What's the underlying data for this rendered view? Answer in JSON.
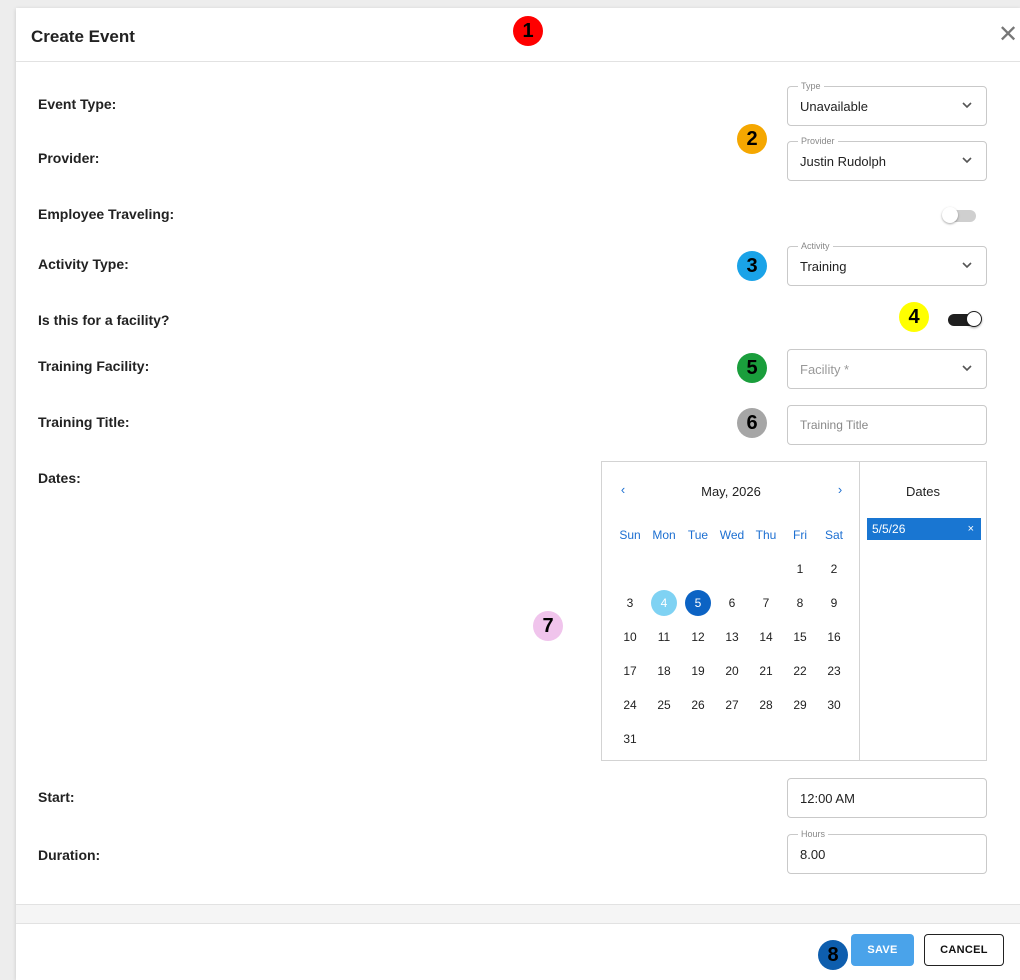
{
  "dialog": {
    "title": "Create Event",
    "close_glyph": "✕"
  },
  "rows": {
    "event_type": {
      "label": "Event Type:",
      "field_legend": "Type",
      "value": "Unavailable"
    },
    "provider": {
      "label": "Provider:",
      "field_legend": "Provider",
      "value": "Justin Rudolph"
    },
    "employee_traveling": {
      "label": "Employee Traveling:",
      "on": false
    },
    "activity_type": {
      "label": "Activity Type:",
      "field_legend": "Activity",
      "value": "Training"
    },
    "for_facility": {
      "label": "Is this for a facility?",
      "on": true
    },
    "training_facility": {
      "label": "Training Facility:",
      "placeholder": "Facility *"
    },
    "training_title": {
      "label": "Training Title:",
      "placeholder": "Training Title",
      "value": ""
    },
    "dates": {
      "label": "Dates:"
    },
    "start": {
      "label": "Start:",
      "value": "12:00 AM"
    },
    "duration": {
      "label": "Duration:",
      "field_legend": "Hours",
      "value": "8.00"
    }
  },
  "calendar": {
    "month_label": "May, 2026",
    "prev_glyph": "‹",
    "next_glyph": "›",
    "weekdays": [
      "Sun",
      "Mon",
      "Tue",
      "Wed",
      "Thu",
      "Fri",
      "Sat"
    ],
    "first_weekday_index": 5,
    "days_in_month": 31,
    "today": 4,
    "selected": [
      5
    ],
    "selected_panel_title": "Dates",
    "selected_dates": [
      "5/5/26"
    ],
    "chip_remove_glyph": "×"
  },
  "footer": {
    "save_label": "SAVE",
    "cancel_label": "CANCEL"
  },
  "markers": [
    {
      "label": "1",
      "color": "#ff0000"
    },
    {
      "label": "2",
      "color": "#f5a700"
    },
    {
      "label": "3",
      "color": "#1aa3e8"
    },
    {
      "label": "4",
      "color": "#ffff00"
    },
    {
      "label": "5",
      "color": "#1a9e3c"
    },
    {
      "label": "6",
      "color": "#a6a6a6"
    },
    {
      "label": "7",
      "color": "#f0c4ec"
    },
    {
      "label": "8",
      "color": "#0e5eae"
    }
  ],
  "colors": {
    "accent": "#1976d2",
    "save_button": "#4aa3ea",
    "today_highlight": "#7fd2f3",
    "selected_day": "#0c63c4"
  }
}
